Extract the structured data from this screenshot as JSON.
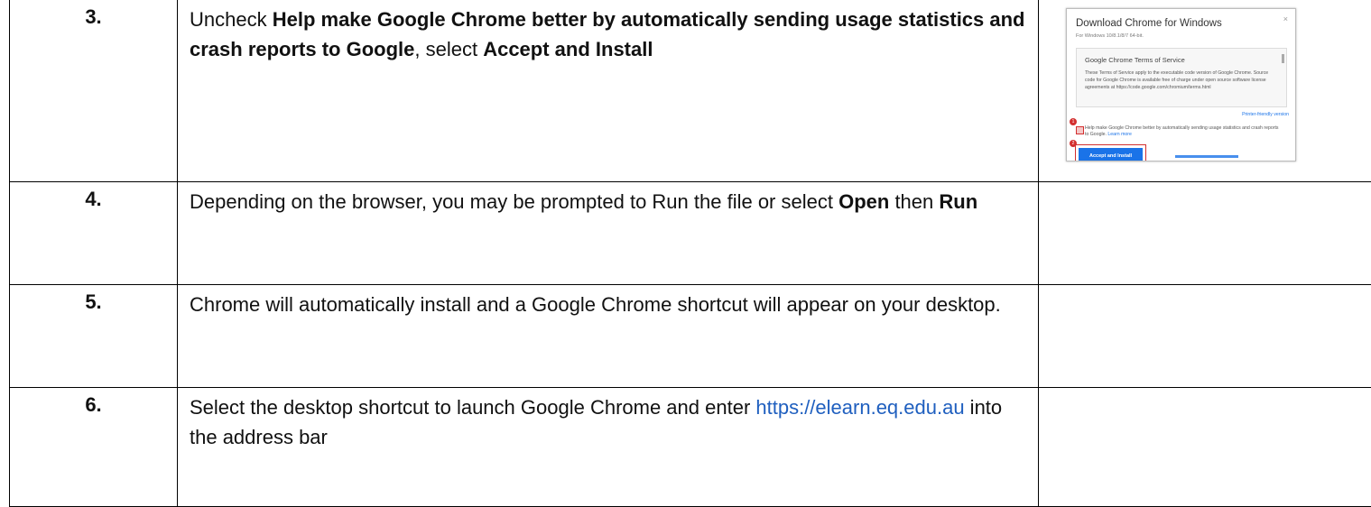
{
  "steps": [
    {
      "number": "3.",
      "parts": [
        {
          "t": "Uncheck ",
          "b": false
        },
        {
          "t": "Help make Google Chrome better by automatically sending usage statistics and crash reports to Google",
          "b": true
        },
        {
          "t": ", select ",
          "b": false
        },
        {
          "t": "Accept and Install",
          "b": true
        }
      ]
    },
    {
      "number": "4.",
      "parts": [
        {
          "t": "Depending on the browser, you may be prompted to Run the file or select ",
          "b": false
        },
        {
          "t": "Open",
          "b": true
        },
        {
          "t": " then ",
          "b": false
        },
        {
          "t": "Run",
          "b": true
        }
      ]
    },
    {
      "number": "5.",
      "parts": [
        {
          "t": "Chrome will automatically install and a Google Chrome shortcut will appear on your desktop.",
          "b": false
        }
      ]
    },
    {
      "number": "6.",
      "parts": [
        {
          "t": "Select the desktop shortcut to launch Google Chrome and enter ",
          "b": false
        },
        {
          "t": "https://elearn.eq.edu.au",
          "b": false,
          "link": true
        },
        {
          "t": " into the address bar",
          "b": false
        }
      ]
    }
  ],
  "screenshot": {
    "title": "Download Chrome for Windows",
    "subtitle": "For Windows 10/8.1/8/7 64-bit.",
    "close_glyph": "×",
    "tos_heading": "Google Chrome Terms of Service",
    "tos_body": "These Terms of Service apply to the executable code version of Google Chrome. Source code for Google Chrome is available free of charge under open source software license agreements at https://code.google.com/chromium/terms.html",
    "printer_link": "Printer-friendly version",
    "checkbox_label": "Help make Google Chrome better by automatically sending usage statistics and crash reports to Google.",
    "learn_more": "Learn more",
    "button": "Accept and Install",
    "badge_1": "1",
    "badge_2": "2"
  }
}
